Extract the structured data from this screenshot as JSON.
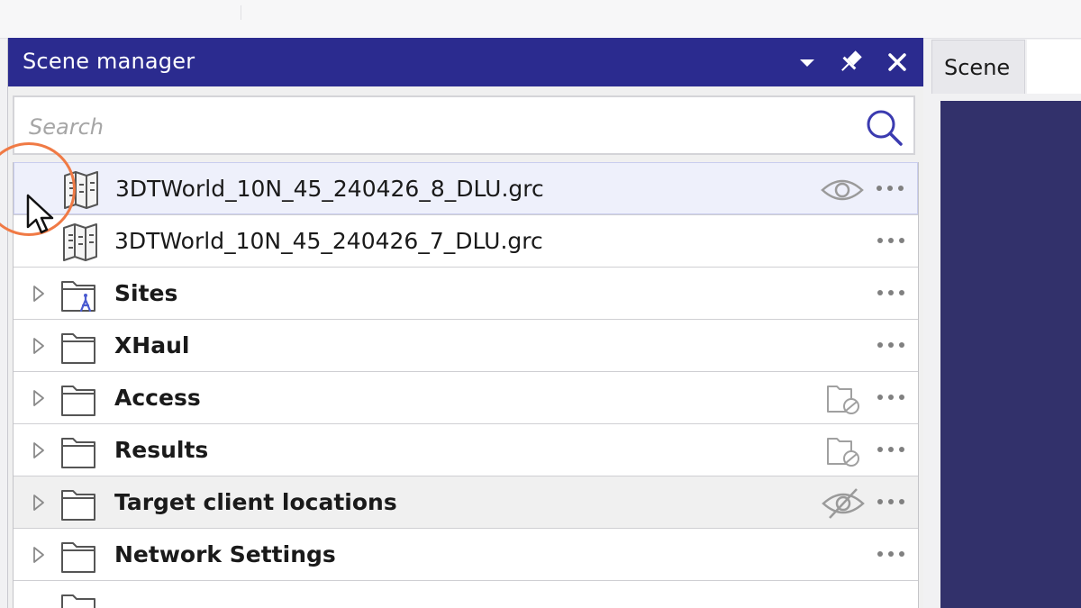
{
  "panel": {
    "title": "Scene manager",
    "header_color": "#2b2b8f",
    "buttons": [
      "dropdown-arrow-icon",
      "pin-icon",
      "close-icon"
    ]
  },
  "search": {
    "placeholder": "Search",
    "value": ""
  },
  "rows": [
    {
      "label": "3DTWorld_10N_45_240426_8_DLU.grc",
      "bold": false,
      "icon": "map-file-icon",
      "state_icon": "eye-icon",
      "expandable": false,
      "selected": true
    },
    {
      "label": "3DTWorld_10N_45_240426_7_DLU.grc",
      "bold": false,
      "icon": "map-file-icon",
      "state_icon": null,
      "expandable": false,
      "selected": false
    },
    {
      "label": "Sites",
      "bold": true,
      "icon": "sites-folder-icon",
      "state_icon": null,
      "expandable": true
    },
    {
      "label": "XHaul",
      "bold": true,
      "icon": "folder-icon",
      "state_icon": null,
      "expandable": true
    },
    {
      "label": "Access",
      "bold": true,
      "icon": "folder-icon",
      "state_icon": "folder-hidden-icon",
      "expandable": true
    },
    {
      "label": "Results",
      "bold": true,
      "icon": "folder-icon",
      "state_icon": "folder-hidden-icon",
      "expandable": true
    },
    {
      "label": "Target client locations",
      "bold": true,
      "icon": "folder-icon",
      "state_icon": "eye-slash-icon",
      "expandable": true,
      "hovered": true
    },
    {
      "label": "Network Settings",
      "bold": true,
      "icon": "folder-icon",
      "state_icon": null,
      "expandable": true
    }
  ],
  "more_icon": "more-options-icon",
  "scene_tab": {
    "label": "Scene",
    "view_color": "#32316b"
  },
  "accent_colors": {
    "highlight_ring": "#f07a45",
    "selected_row": "#eef0fb"
  }
}
